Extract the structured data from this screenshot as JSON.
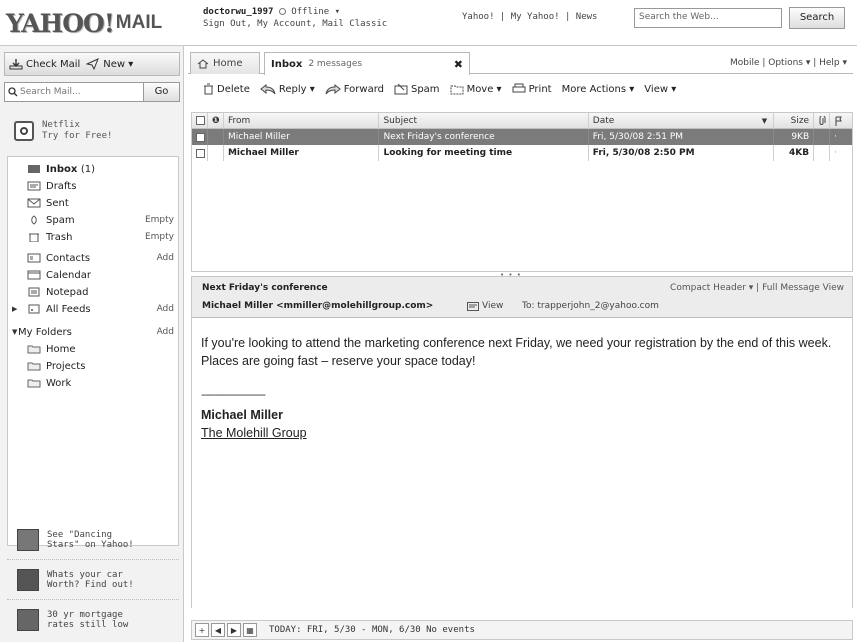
{
  "header": {
    "logo_yahoo": "YAHOO!",
    "logo_mail": "MAIL",
    "username": "doctorwu_1997",
    "status": "Offline ▾",
    "account_links": "Sign Out, My Account, Mail Classic",
    "top_links": "Yahoo! | My Yahoo! | News",
    "search_placeholder": "Search the Web...",
    "search_button": "Search"
  },
  "sidebar": {
    "check_mail": "Check Mail",
    "new_label": "New ▾",
    "search_placeholder": "Search Mail...",
    "go_button": "Go",
    "netflix_promo": [
      "Netflix",
      "Try for Free!"
    ],
    "folders": [
      {
        "label": "Inbox",
        "count": "(1)",
        "action": "",
        "icon": "inbox-icon"
      },
      {
        "label": "Drafts",
        "action": "",
        "icon": "drafts-icon"
      },
      {
        "label": "Sent",
        "action": "",
        "icon": "sent-icon"
      },
      {
        "label": "Spam",
        "action": "Empty",
        "icon": "spam-icon"
      },
      {
        "label": "Trash",
        "action": "Empty",
        "icon": "trash-icon"
      },
      {
        "label": "Contacts",
        "action": "Add",
        "icon": "contacts-icon"
      },
      {
        "label": "Calendar",
        "action": "",
        "icon": "calendar-icon"
      },
      {
        "label": "Notepad",
        "action": "",
        "icon": "notepad-icon"
      },
      {
        "label": "All Feeds",
        "action": "Add",
        "icon": "feeds-icon"
      },
      {
        "label": "My Folders",
        "action": "Add",
        "icon": ""
      },
      {
        "label": "Home",
        "action": "",
        "icon": "folder-icon"
      },
      {
        "label": "Projects",
        "action": "",
        "icon": "folder-icon"
      },
      {
        "label": "Work",
        "action": "",
        "icon": "folder-icon"
      }
    ],
    "promos": [
      [
        "See \"Dancing",
        "Stars\" on Yahoo!"
      ],
      [
        "Whats your car",
        "Worth? Find out!"
      ],
      [
        "30 yr mortgage",
        "rates still low"
      ]
    ]
  },
  "tabs": {
    "home": "Home",
    "inbox": "Inbox",
    "inbox_count": "2 messages",
    "close": "✖",
    "right_links": "Mobile | Options ▾ | Help ▾"
  },
  "toolbar": {
    "delete": "Delete",
    "reply": "Reply ▾",
    "forward": "Forward",
    "spam": "Spam",
    "move": "Move ▾",
    "print": "Print",
    "more_actions": "More Actions ▾",
    "view": "View ▾"
  },
  "message_list": {
    "headers": {
      "from": "From",
      "subject": "Subject",
      "date": "Date",
      "size": "Size"
    },
    "rows": [
      {
        "from": "Michael Miller",
        "subject": "Next Friday's conference",
        "date": "Fri, 5/30/08 2:51 PM",
        "size": "9KB",
        "flag": "·"
      },
      {
        "from": "Michael Miller",
        "subject": "Looking for meeting time",
        "date": "Fri, 5/30/08 2:50 PM",
        "size": "4KB",
        "flag": "·"
      }
    ]
  },
  "preview": {
    "subject": "Next Friday's conference",
    "header_links": "Compact Header ▾ | Full Message View",
    "from": "Michael Miller <mmiller@molehillgroup.com>",
    "view": "View",
    "to": "To: trapperjohn_2@yahoo.com",
    "body": "If you're looking to attend the marketing conference next Friday, we need your registration by the end of this week. Places are going fast – reserve your space today!",
    "separator": "------------------------",
    "sig_name": "Michael Miller",
    "sig_company": "The Molehill Group"
  },
  "calendar_bar": {
    "text": "TODAY: FRI, 5/30 - MON, 6/30  No events"
  }
}
